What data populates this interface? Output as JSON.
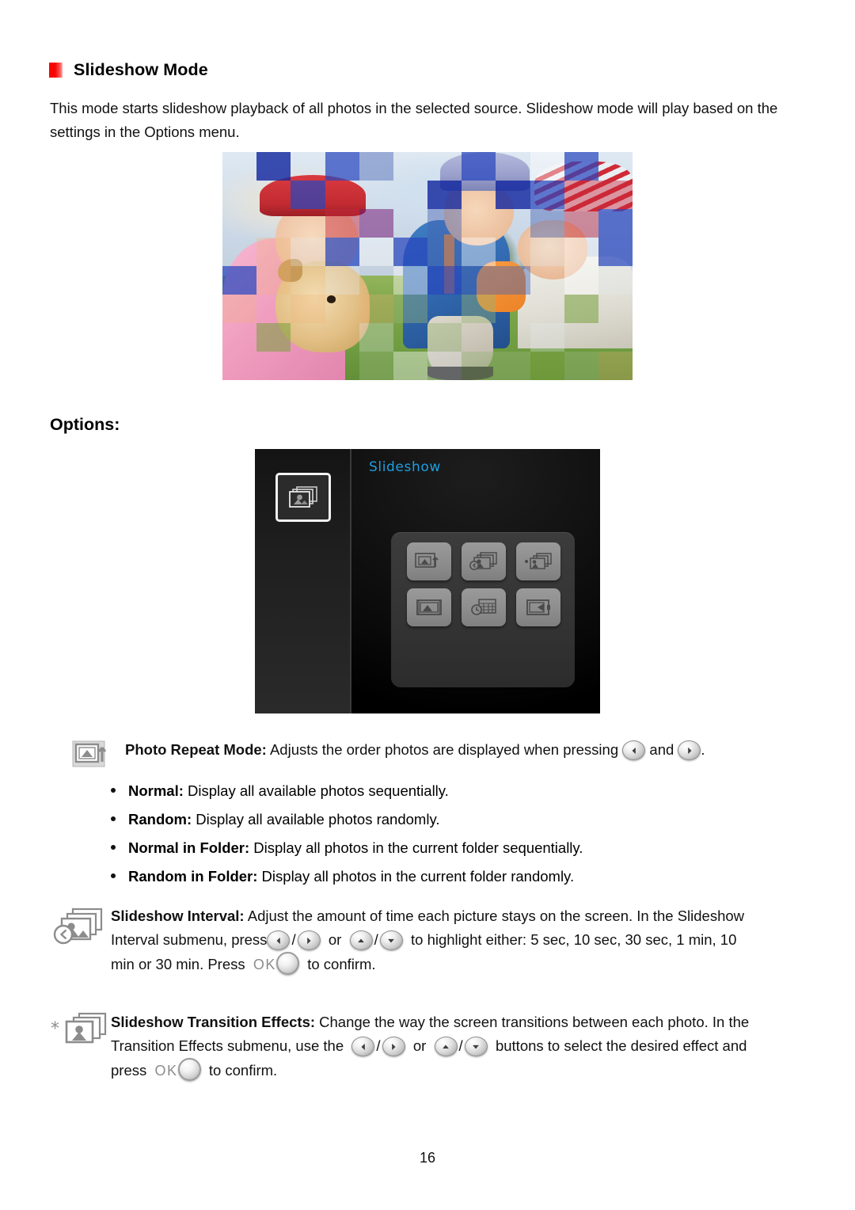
{
  "document": {
    "page_number": "16",
    "accent_color": "#ff0000",
    "menu_title_color": "#1e9fe0"
  },
  "heading": {
    "bullet_icon": "red-square-bullet",
    "title": "Slideshow Mode"
  },
  "intro": {
    "paragraph": "This mode starts slideshow playback of all photos in the selected source. Slideshow mode will play based on the settings in the Options menu."
  },
  "photo": {
    "caption": "",
    "alt": "Slideshow mosaic transition example showing children and a puppy outdoors"
  },
  "options": {
    "label": "Options:"
  },
  "menu_screenshot": {
    "sidebar_icon": "slideshow-stack-icon",
    "title": "Slideshow",
    "tiles": [
      {
        "icon": "photo-repeat-mode-icon"
      },
      {
        "icon": "slideshow-interval-icon"
      },
      {
        "icon": "slideshow-transition-effects-icon"
      },
      {
        "icon": "slideshow-display-mode-icon"
      },
      {
        "icon": "slideshow-calendar-clock-icon"
      },
      {
        "icon": "slideshow-exit-icon"
      }
    ]
  },
  "items": [
    {
      "icon": "photo-repeat-mode-icon",
      "title": "Photo Repeat Mode:",
      "text_before_buttons": " Adjusts the order photos are displayed when pressing ",
      "conjunction": " and ",
      "text_after_buttons": ".",
      "buttons": [
        "left-arrow-button",
        "right-arrow-button"
      ],
      "bullets": [
        {
          "term": "Normal:",
          "description": " Display all available photos sequentially."
        },
        {
          "term": "Random:",
          "description": " Display all available photos randomly."
        },
        {
          "term": "Normal in Folder:",
          "description": " Display all photos in the current folder sequentially."
        },
        {
          "term": "Random in Folder:",
          "description": " Display all photos in the current folder randomly."
        }
      ]
    },
    {
      "icon": "slideshow-interval-icon",
      "title": "Slideshow Interval:",
      "line1": " Adjust the amount of time each picture stays on the screen. In the Slideshow",
      "line2_a": "Interval submenu, press",
      "line2_or": "or",
      "line2_b": "to highlight either: 5 sec, 10 sec, 30 sec, 1 min, 10",
      "line3_a": "min or 30 min. Press",
      "ok_label": "OK",
      "line3_b": "to confirm."
    },
    {
      "icon": "slideshow-transition-effects-icon",
      "title": "Slideshow Transition Effects:",
      "line1": " Change the way the screen transitions between each photo. In the",
      "line2_a": "Transition Effects submenu, use the",
      "line2_or": "or",
      "line2_b": "buttons to select the desired effect and",
      "line3_a": "press",
      "ok_label": "OK",
      "line3_b": "to confirm."
    }
  ]
}
